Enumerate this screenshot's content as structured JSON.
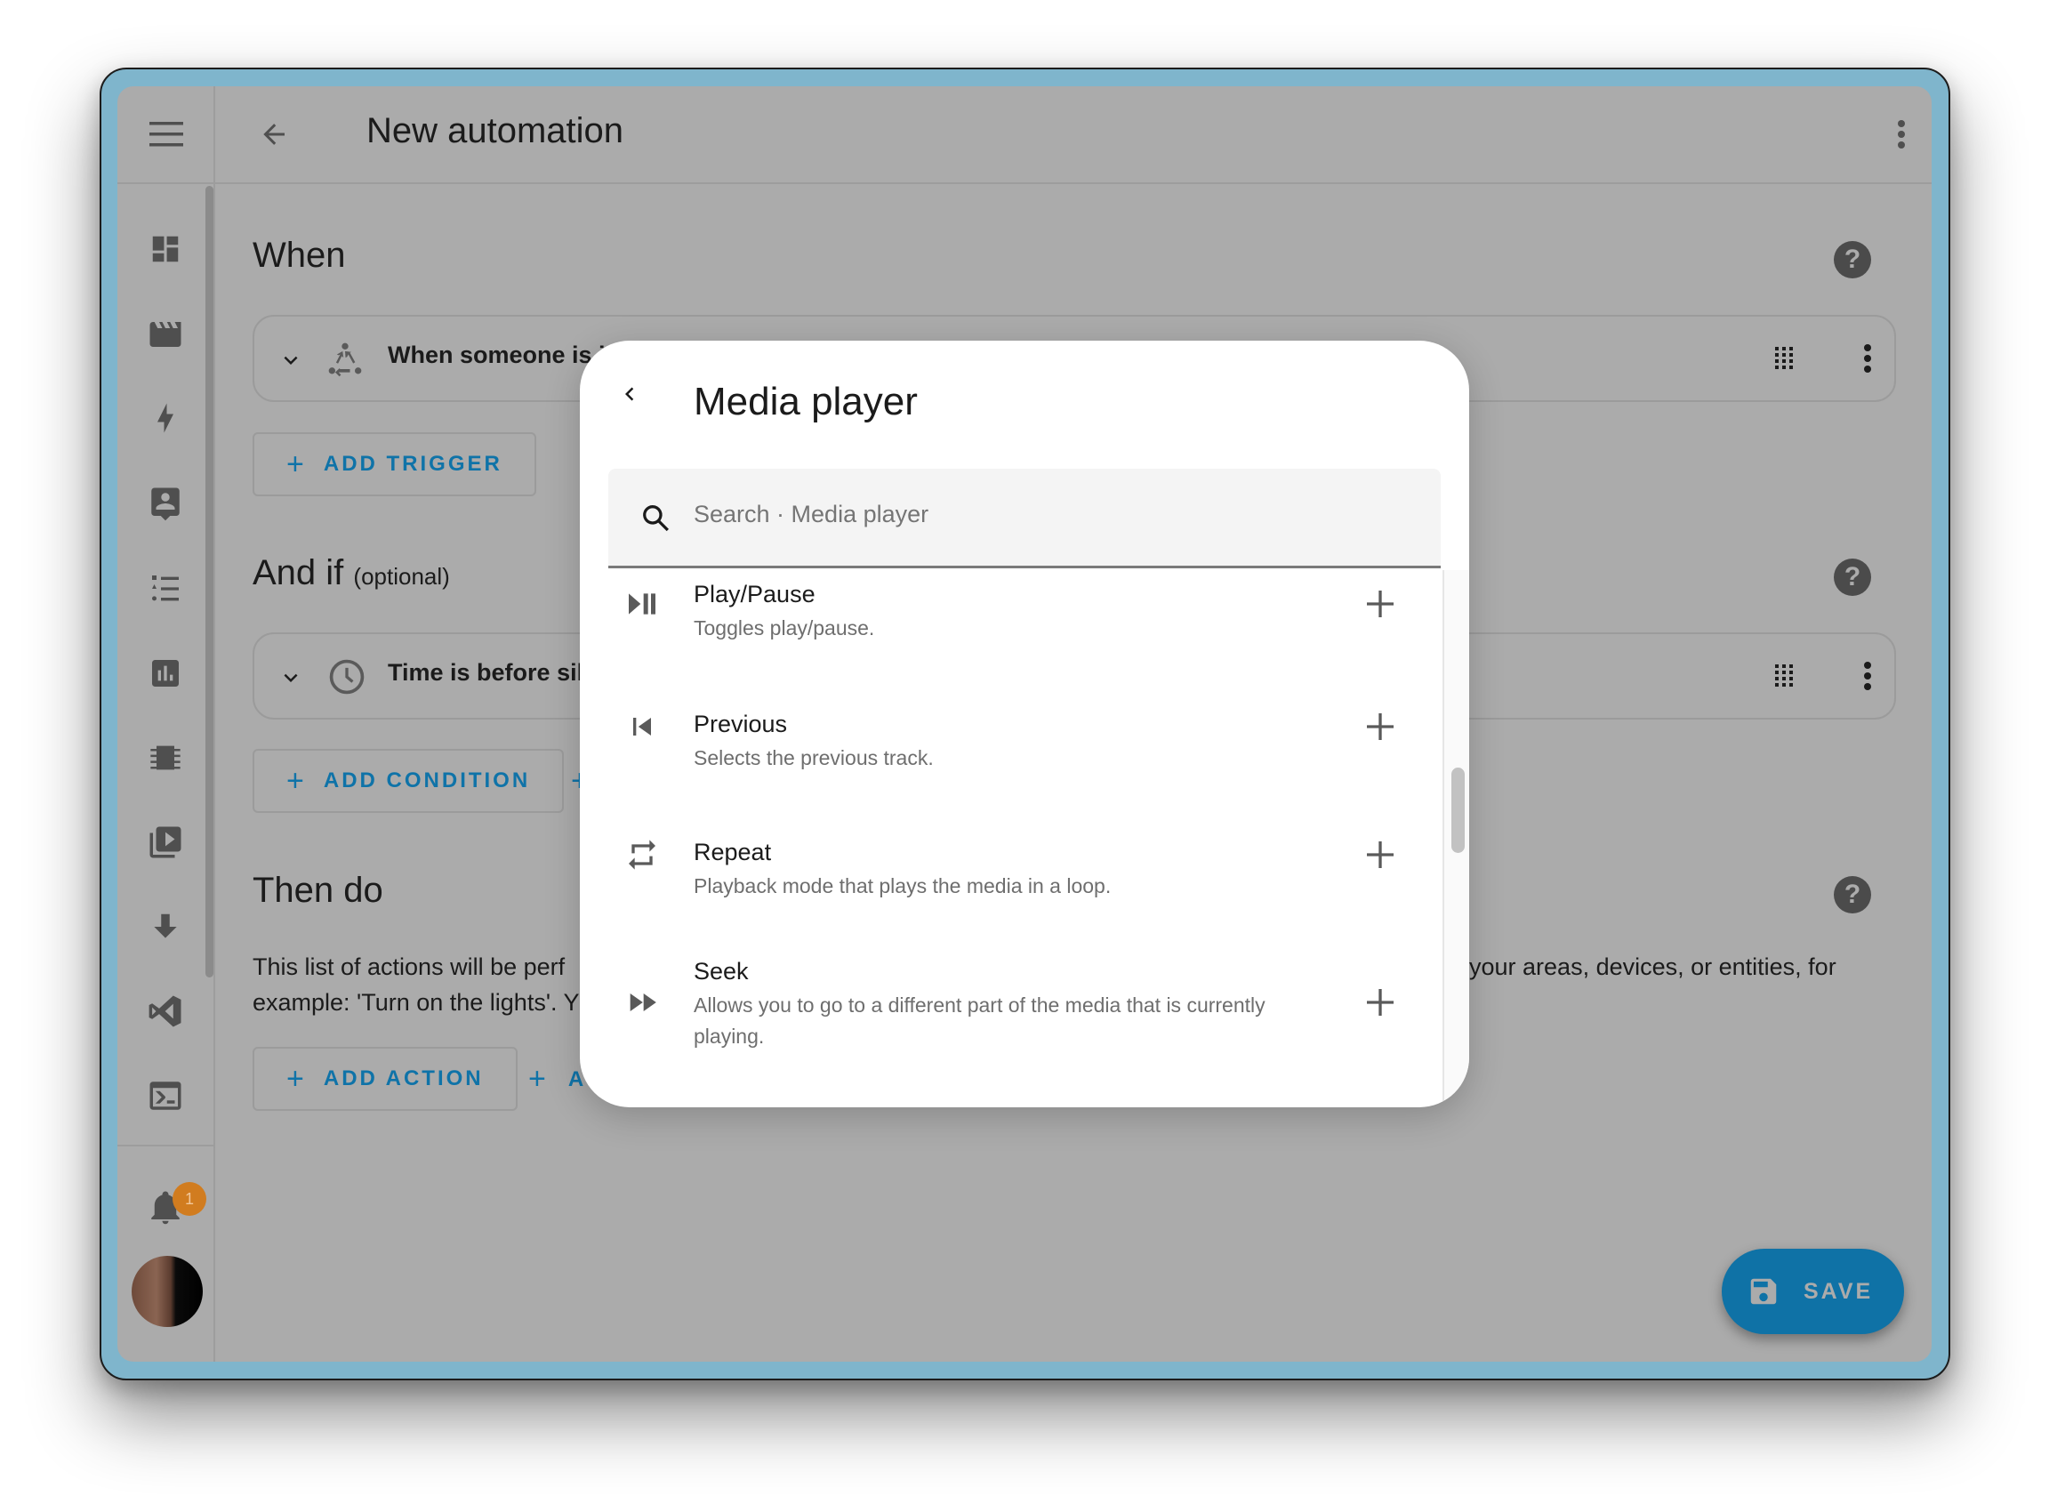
{
  "header": {
    "title": "New automation",
    "menu_icon": "hamburger-menu-icon",
    "back_icon": "arrow-left-icon",
    "overflow_icon": "dots-vertical-icon"
  },
  "sidebar": {
    "items": [
      {
        "name": "overview",
        "icon": "dashboard-icon"
      },
      {
        "name": "media",
        "icon": "clapperboard-icon"
      },
      {
        "name": "energy",
        "icon": "lightning-bolt-icon"
      },
      {
        "name": "map",
        "icon": "account-box-icon"
      },
      {
        "name": "logbook",
        "icon": "format-list-icon"
      },
      {
        "name": "history",
        "icon": "chart-box-icon"
      },
      {
        "name": "hardware",
        "icon": "chip-icon"
      },
      {
        "name": "media-browser",
        "icon": "play-box-multiple-icon"
      },
      {
        "name": "downloads",
        "icon": "arrow-down-icon"
      },
      {
        "name": "vscode",
        "icon": "vscode-icon"
      },
      {
        "name": "terminal",
        "icon": "console-icon"
      }
    ],
    "notifications_count": "1"
  },
  "sections": {
    "when": {
      "title": "When",
      "trigger_text": "When someone is i",
      "add_button": "ADD TRIGGER"
    },
    "and_if": {
      "title": "And if",
      "optional": "(optional)",
      "condition_text": "Time is before sil",
      "add_button": "ADD CONDITION"
    },
    "then_do": {
      "title": "Then do",
      "description_left_1": "This list of actions will be perf",
      "description_left_2": "example: 'Turn on the lights'. Y",
      "description_right_1": "your areas, devices, or entities, for",
      "add_button": "ADD ACTION",
      "second_button_partial": "A"
    }
  },
  "save_button": "SAVE",
  "dialog": {
    "title": "Media player",
    "search_placeholder": "Search · Media player",
    "items": [
      {
        "title": "Play/Pause",
        "subtitle": "Toggles play/pause.",
        "icon": "play-pause-icon"
      },
      {
        "title": "Previous",
        "subtitle": "Selects the previous track.",
        "icon": "skip-previous-icon"
      },
      {
        "title": "Repeat",
        "subtitle": "Playback mode that plays the media in a loop.",
        "icon": "repeat-icon"
      },
      {
        "title": "Seek",
        "subtitle": "Allows you to go to a different part of the media that is currently playing.",
        "icon": "fast-forward-icon"
      }
    ]
  },
  "colors": {
    "accent": "#0f73a8",
    "fab": "#0f72a6",
    "badge": "#d17c1f",
    "scrim": "#ababab",
    "frame": "#7fb5cc"
  }
}
